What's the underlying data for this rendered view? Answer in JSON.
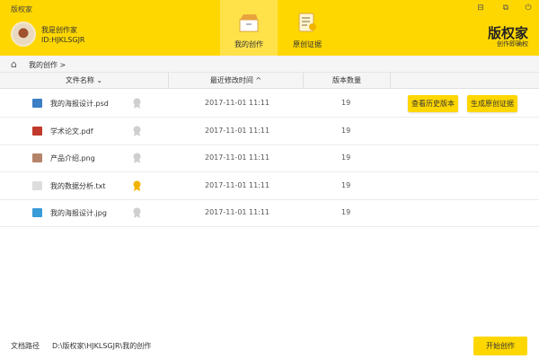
{
  "app": {
    "title": "版权家",
    "brand": "版权家",
    "slogan": "创作即确权"
  },
  "user": {
    "name": "我是创作家",
    "id": "ID:HJKLSGJR"
  },
  "tabs": [
    {
      "label": "我的创作",
      "active": true
    },
    {
      "label": "原创证据",
      "active": false
    }
  ],
  "window_buttons": [
    "minimize-icon",
    "external-icon",
    "power-icon"
  ],
  "breadcrumb": {
    "current": "我的创作",
    "sep": ">"
  },
  "table": {
    "headers": {
      "name": "文件名称 ⌄",
      "time": "最近修改时间 ^",
      "versions": "版本数量"
    },
    "rows": [
      {
        "name": "我的海报设计.psd",
        "type": "psd",
        "color": "#3b7fc4",
        "certified": false,
        "time": "2017-11-01   11:11",
        "versions": "19"
      },
      {
        "name": "学术论文.pdf",
        "type": "pdf",
        "color": "#c0392b",
        "certified": false,
        "time": "2017-11-01   11:11",
        "versions": "19"
      },
      {
        "name": "产品介绍.png",
        "type": "png",
        "color": "#b5836a",
        "certified": false,
        "time": "2017-11-01   11:11",
        "versions": "19"
      },
      {
        "name": "我的数据分析.txt",
        "type": "txt",
        "color": "#dddddd",
        "certified": true,
        "time": "2017-11-01   11:11",
        "versions": "19"
      },
      {
        "name": "我的海报设计.jpg",
        "type": "jpg",
        "color": "#3a9bd9",
        "certified": false,
        "time": "2017-11-01   11:11",
        "versions": "19"
      }
    ],
    "actions": {
      "history": "查看历史版本",
      "evidence": "生成原创证据"
    }
  },
  "footer": {
    "path_label": "文档路径",
    "path_value": "D:\\版权家\\HJKLSGJR\\我的创作",
    "start_button": "开始创作"
  },
  "colors": {
    "accent": "#FFD700",
    "medal_gold": "#f0b400",
    "medal_gray": "#cfcfcf"
  }
}
